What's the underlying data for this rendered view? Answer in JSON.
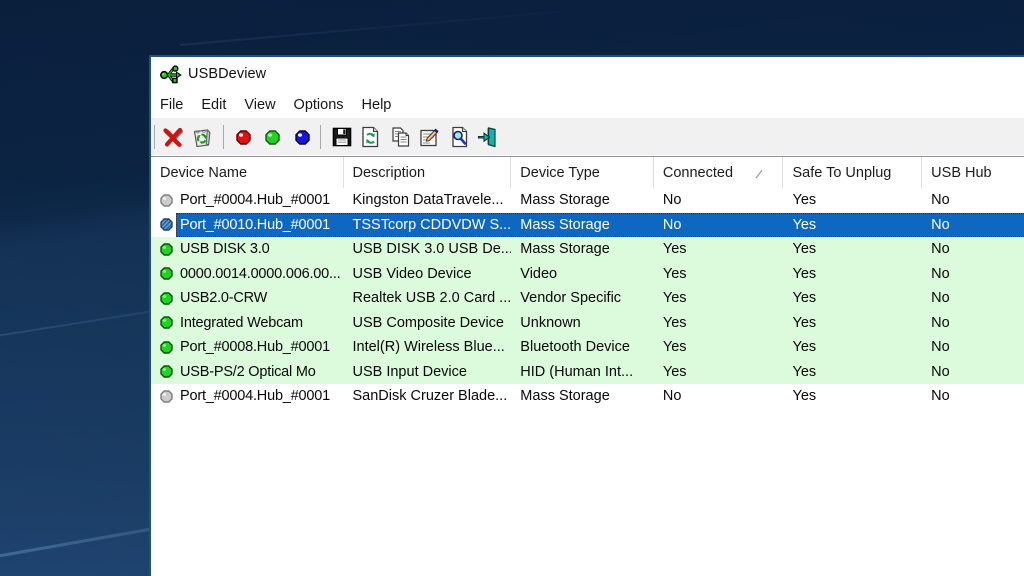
{
  "app": {
    "title": "USBDeview",
    "window_icon": "usb-logo-icon"
  },
  "menu": {
    "items": [
      {
        "label": "File"
      },
      {
        "label": "Edit"
      },
      {
        "label": "View"
      },
      {
        "label": "Options"
      },
      {
        "label": "Help"
      }
    ]
  },
  "toolbar": {
    "buttons": [
      {
        "name": "uninstall-button",
        "icon": "red-x-icon"
      },
      {
        "name": "remove-device-button",
        "icon": "trash-recycle-icon"
      },
      {
        "name": "red-ball-button",
        "icon": "red-ball-icon"
      },
      {
        "name": "green-ball-button",
        "icon": "green-ball-icon"
      },
      {
        "name": "blue-ball-button",
        "icon": "blue-ball-icon"
      },
      {
        "name": "save-report-button",
        "icon": "floppy-icon"
      },
      {
        "name": "refresh-button",
        "icon": "refresh-icon"
      },
      {
        "name": "copy-button",
        "icon": "copy-icon"
      },
      {
        "name": "properties-button",
        "icon": "properties-icon"
      },
      {
        "name": "find-button",
        "icon": "find-icon"
      },
      {
        "name": "exit-button",
        "icon": "exit-icon"
      }
    ]
  },
  "table": {
    "columns": [
      {
        "label": "Device Name"
      },
      {
        "label": "Description"
      },
      {
        "label": "Device Type"
      },
      {
        "label": "Connected",
        "sorted": true
      },
      {
        "label": "Safe To Unplug"
      },
      {
        "label": "USB Hub"
      }
    ],
    "rows": [
      {
        "status": "disconnected",
        "cells": [
          "Port_#0004.Hub_#0001",
          "Kingston DataTravele...",
          "Mass Storage",
          "No",
          "Yes",
          "No"
        ]
      },
      {
        "status": "disconnected",
        "selected": true,
        "cells": [
          "Port_#0010.Hub_#0001",
          "TSSTcorp CDDVDW S...",
          "Mass Storage",
          "No",
          "Yes",
          "No"
        ]
      },
      {
        "status": "connected",
        "cells": [
          "USB DISK 3.0",
          "USB DISK 3.0 USB De...",
          "Mass Storage",
          "Yes",
          "Yes",
          "No"
        ]
      },
      {
        "status": "connected",
        "cells": [
          "0000.0014.0000.006.00...",
          "USB Video Device",
          "Video",
          "Yes",
          "Yes",
          "No"
        ]
      },
      {
        "status": "connected",
        "cells": [
          "USB2.0-CRW",
          "Realtek USB 2.0 Card ...",
          "Vendor Specific",
          "Yes",
          "Yes",
          "No"
        ]
      },
      {
        "status": "connected",
        "cells": [
          "Integrated Webcam",
          "USB Composite Device",
          "Unknown",
          "Yes",
          "Yes",
          "No"
        ]
      },
      {
        "status": "connected",
        "cells": [
          "Port_#0008.Hub_#0001",
          "Intel(R) Wireless Blue...",
          "Bluetooth Device",
          "Yes",
          "Yes",
          "No"
        ]
      },
      {
        "status": "connected",
        "cells": [
          "USB-PS/2 Optical Mo",
          "USB Input Device",
          "HID (Human Int...",
          "Yes",
          "Yes",
          "No"
        ]
      },
      {
        "status": "disconnected",
        "cells": [
          "Port_#0004.Hub_#0001",
          "SanDisk Cruzer Blade...",
          "Mass Storage",
          "No",
          "Yes",
          "No"
        ]
      }
    ]
  },
  "colors": {
    "selection_blue": "#0e67c0",
    "connected_row_green": "#dcfadc",
    "connected_ball_green": "#21d324",
    "disconnected_ball_gray": "#cccccc",
    "window_border_blue": "#1f5185",
    "desktop_navy": "#0f2d52"
  }
}
